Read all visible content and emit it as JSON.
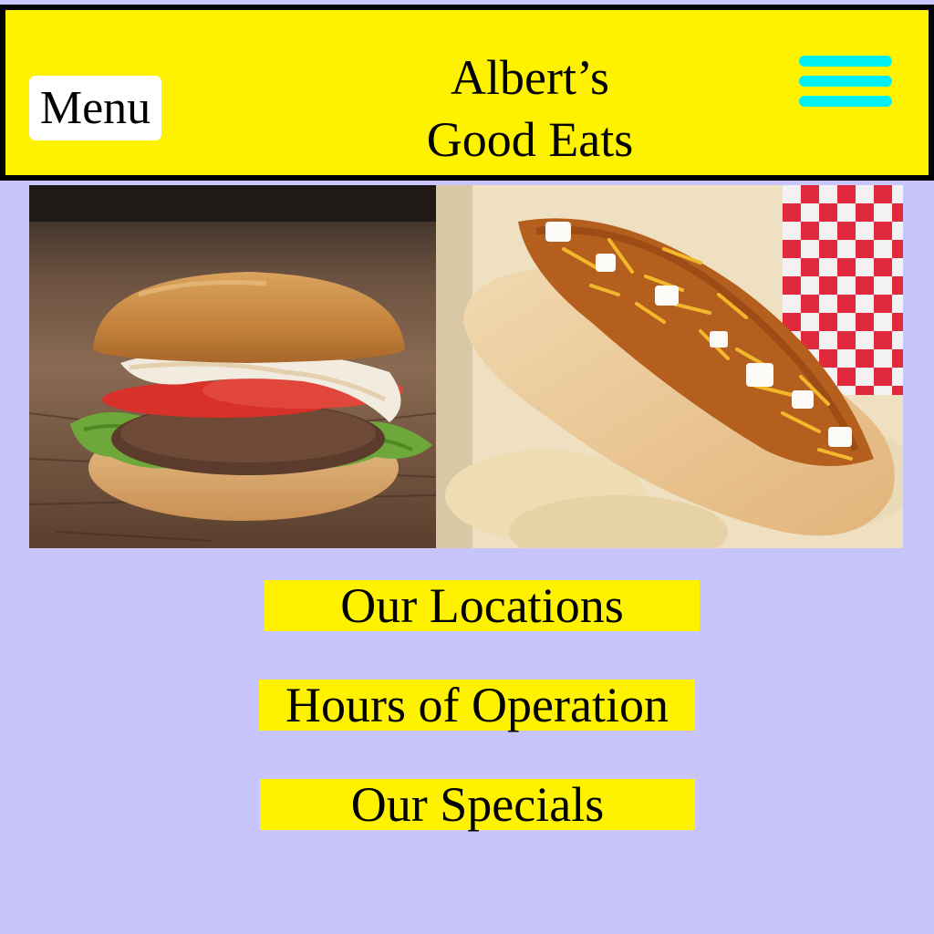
{
  "header": {
    "menu_label": "Menu",
    "title_line1": "Albert’s",
    "title_line2": "Good Eats",
    "hamburger_icon": "hamburger-menu-icon"
  },
  "photos": {
    "left": "burger",
    "right": "chili cheese hot dog"
  },
  "nav": {
    "locations": "Our Locations",
    "hours": "Hours of Operation",
    "specials": "Our Specials"
  },
  "colors": {
    "background": "#c8c5fd",
    "header": "#fff200",
    "link_highlight": "#fff200",
    "hamburger": "#00f0f6"
  }
}
